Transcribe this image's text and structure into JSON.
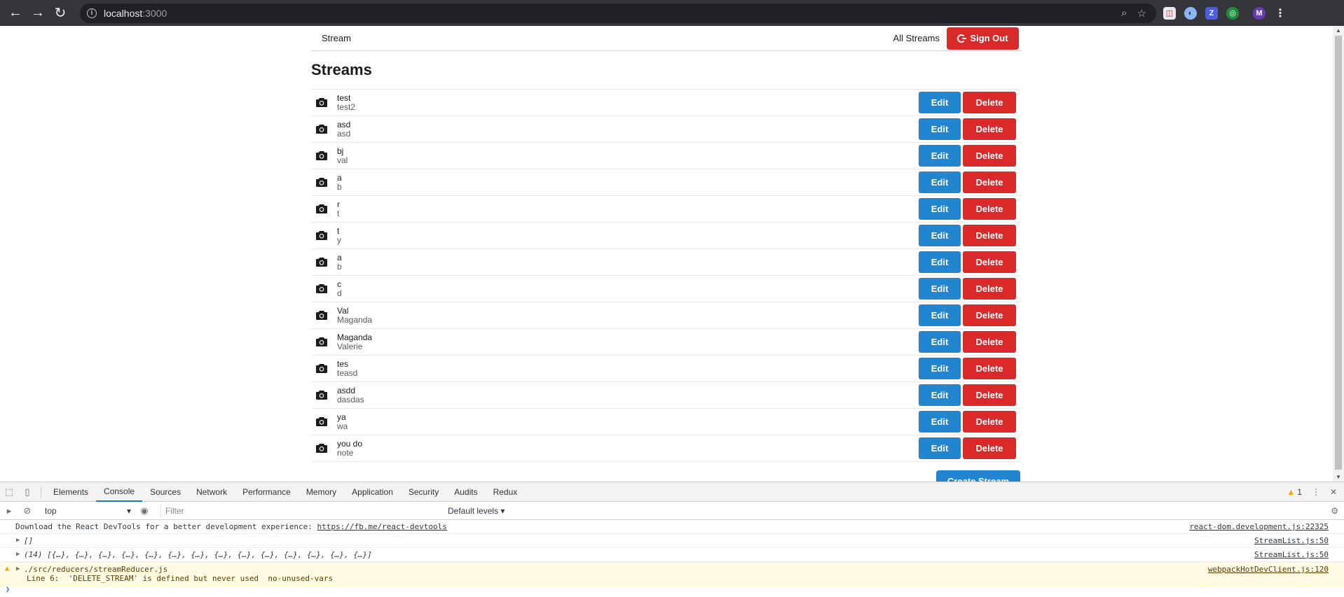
{
  "browser": {
    "url_host": "localhost",
    "url_port": ":3000"
  },
  "header": {
    "brand": "Stream",
    "all_streams": "All Streams",
    "sign_out": "Sign Out"
  },
  "page": {
    "title": "Streams",
    "edit_label": "Edit",
    "delete_label": "Delete",
    "create_label": "Create Stream"
  },
  "streams": [
    {
      "title": "test",
      "description": "test2"
    },
    {
      "title": "asd",
      "description": "asd"
    },
    {
      "title": "bj",
      "description": "val"
    },
    {
      "title": "a",
      "description": "b"
    },
    {
      "title": "r",
      "description": "t"
    },
    {
      "title": "t",
      "description": "y"
    },
    {
      "title": "a",
      "description": "b"
    },
    {
      "title": "c",
      "description": "d"
    },
    {
      "title": "Val",
      "description": "Maganda"
    },
    {
      "title": "Maganda",
      "description": "Valerie"
    },
    {
      "title": "tes",
      "description": "teasd"
    },
    {
      "title": "asdd",
      "description": "dasdas"
    },
    {
      "title": "ya",
      "description": "wa"
    },
    {
      "title": "you do",
      "description": "note"
    }
  ],
  "devtools": {
    "tabs": [
      "Elements",
      "Console",
      "Sources",
      "Network",
      "Performance",
      "Memory",
      "Application",
      "Security",
      "Audits",
      "Redux"
    ],
    "active_tab": "Console",
    "warning_count": "1",
    "context": "top",
    "filter_placeholder": "Filter",
    "levels": "Default levels",
    "logs": [
      {
        "text": "Download the React DevTools for a better development experience: ",
        "link": "https://fb.me/react-devtools",
        "source": "react-dom.development.js:22325"
      },
      {
        "text": "[]",
        "source": "StreamList.js:50"
      },
      {
        "text": "(14) [{…}, {…}, {…}, {…}, {…}, {…}, {…}, {…}, {…}, {…}, {…}, {…}, {…}, {…}]",
        "source": "StreamList.js:50"
      }
    ],
    "warning": {
      "line1": "./src/reducers/streamReducer.js",
      "line2": "Line 6:  'DELETE_STREAM' is defined but never used  no-unused-vars",
      "source": "webpackHotDevClient.js:120"
    }
  }
}
